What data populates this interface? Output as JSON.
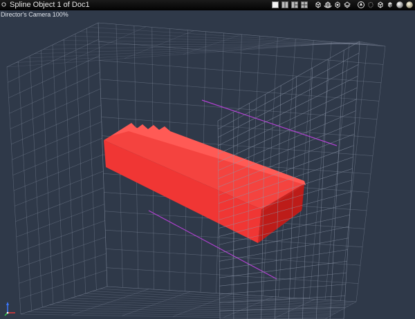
{
  "window": {
    "title": "Spline Object 1 of Doc1"
  },
  "toolbar": {
    "buttons": [
      {
        "icon": "single-view-icon"
      },
      {
        "icon": "two-view-icon"
      },
      {
        "icon": "three-view-icon"
      },
      {
        "icon": "four-view-icon"
      },
      {
        "icon": "camera-move-icon"
      },
      {
        "icon": "camera-rotate-icon"
      },
      {
        "icon": "camera-zoom-icon"
      },
      {
        "icon": "camera-dolly-icon"
      },
      {
        "icon": "navigation-icon"
      },
      {
        "icon": "bounding-box-icon"
      },
      {
        "icon": "wireframe-cube-icon"
      },
      {
        "icon": "solid-cube-icon"
      },
      {
        "icon": "shaded-sphere-icon"
      },
      {
        "icon": "raytrace-sphere-icon"
      }
    ]
  },
  "viewport": {
    "camera_label": "Director's Camera 100%",
    "colors": {
      "background": "#2f3949",
      "grid": "#8e98ab",
      "object": "#f03634",
      "guide": "#b040d0"
    }
  }
}
